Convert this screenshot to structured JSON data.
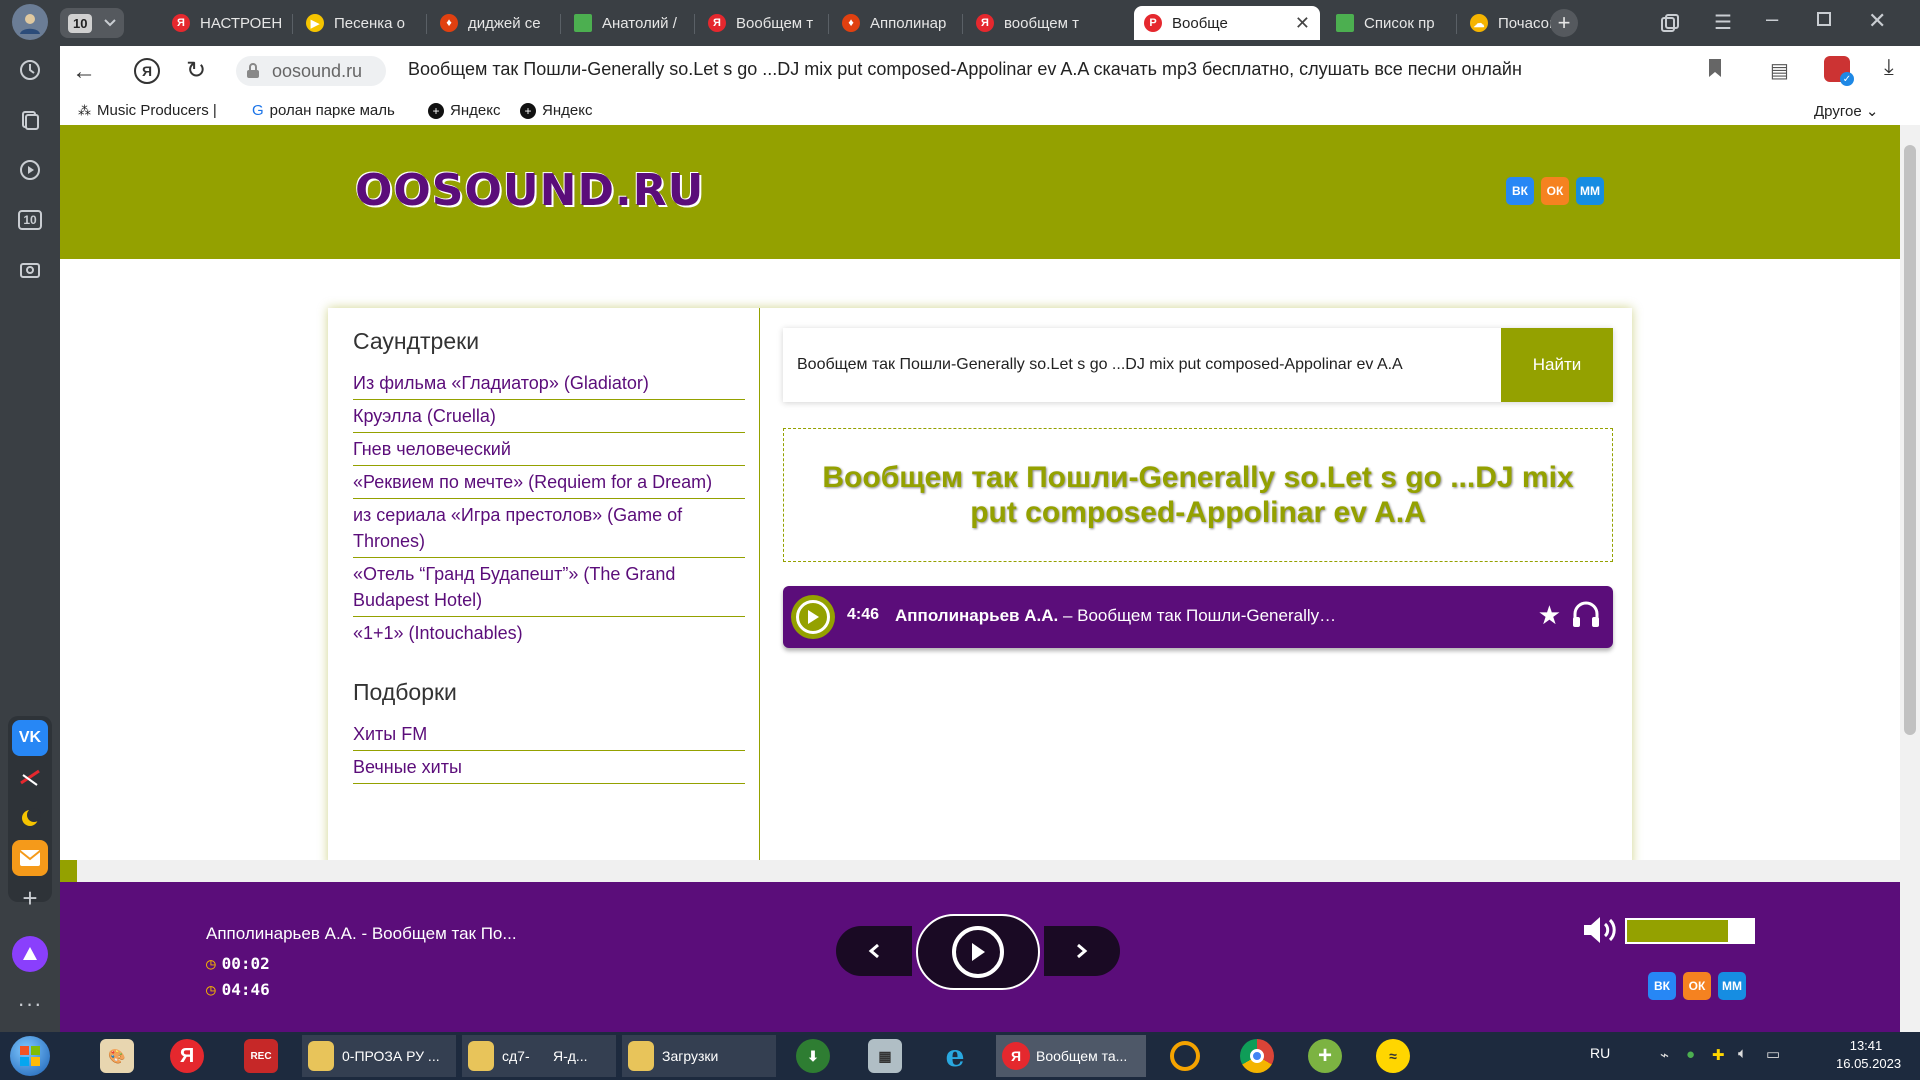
{
  "browser": {
    "tab_counter": "10",
    "tabs": [
      {
        "label": "НАСТРОЕН",
        "icon": "yandex-icon",
        "color": "#e5282e"
      },
      {
        "label": "Песенка о",
        "icon": "play-icon",
        "color": "#f5c400"
      },
      {
        "label": "диджей се",
        "icon": "fire-icon",
        "color": "#e04010"
      },
      {
        "label": "Анатолий /",
        "icon": "green-square-icon",
        "color": "#4caf50"
      },
      {
        "label": "Вообщем т",
        "icon": "yandex-icon",
        "color": "#e5282e"
      },
      {
        "label": "Апполинар",
        "icon": "fire-icon",
        "color": "#e04010"
      },
      {
        "label": "вообщем т",
        "icon": "yandex-icon",
        "color": "#e5282e"
      },
      {
        "label": "Вообще",
        "icon": "p-icon",
        "color": "#e5282e"
      },
      {
        "label": "Список пр",
        "icon": "green-square-icon",
        "color": "#4caf50"
      },
      {
        "label": "Почасовой",
        "icon": "weather-icon",
        "color": "#f5b400"
      }
    ],
    "domain": "oosound.ru",
    "page_title": "Вообщем так Пошли-Generally so.Let s go ...DJ mix put composed-Appolinar ev A.A скачать mp3 бесплатно, слушать все песни онлайн",
    "bookmarks": [
      "Music Producers |",
      "ролан парке маль",
      "Яндекс",
      "Яндекс"
    ],
    "bookmarks_other": "Другое"
  },
  "site": {
    "logo": "OOSOUND.RU",
    "social": [
      "ВК",
      "ОК",
      "ММ"
    ],
    "sections": [
      {
        "title": "Саундтреки",
        "links": [
          "Из фильма «Гладиатор» (Gladiator)",
          "Круэлла (Cruella)",
          "Гнев человеческий",
          "«Реквием по мечте» (Requiem for a Dream)",
          "из сериала «Игра престолов» (Game of Thrones)",
          "«Отель “Гранд Будапешт”» (The Grand Budapest Hotel)",
          "«1+1» (Intouchables)"
        ]
      },
      {
        "title": "Подборки",
        "links": [
          "Хиты FM",
          "Вечные хиты"
        ]
      }
    ],
    "search_value": "Вообщем так Пошли-Generally so.Let s go ...DJ mix put composed-Appolinar ev A.A",
    "search_button": "Найти",
    "heading": "Вообщем так Пошли-Generally so.Let s go ...DJ mix put composed-Appolinar ev A.A",
    "track": {
      "duration": "4:46",
      "artist": "Апполинарьев А.А.",
      "title": " – Вообщем так Пошли-Generally…"
    }
  },
  "player": {
    "now_playing": "Апполинарьев А.А. - Вообщем так По...",
    "elapsed": "00:02",
    "total": "04:46",
    "volume_fraction": 0.8,
    "progress_fraction": 0.007
  },
  "taskbar": {
    "items": [
      {
        "label": "0-ПРОЗА РУ ..."
      },
      {
        "label": "сд7-      Я-д..."
      },
      {
        "label": "Загрузки"
      },
      {
        "label": "Вообщем та..."
      }
    ],
    "lang": "RU",
    "time": "13:41",
    "date": "16.05.2023"
  },
  "colors": {
    "accent_olive": "#94a100",
    "accent_purple": "#5b0d7a"
  }
}
